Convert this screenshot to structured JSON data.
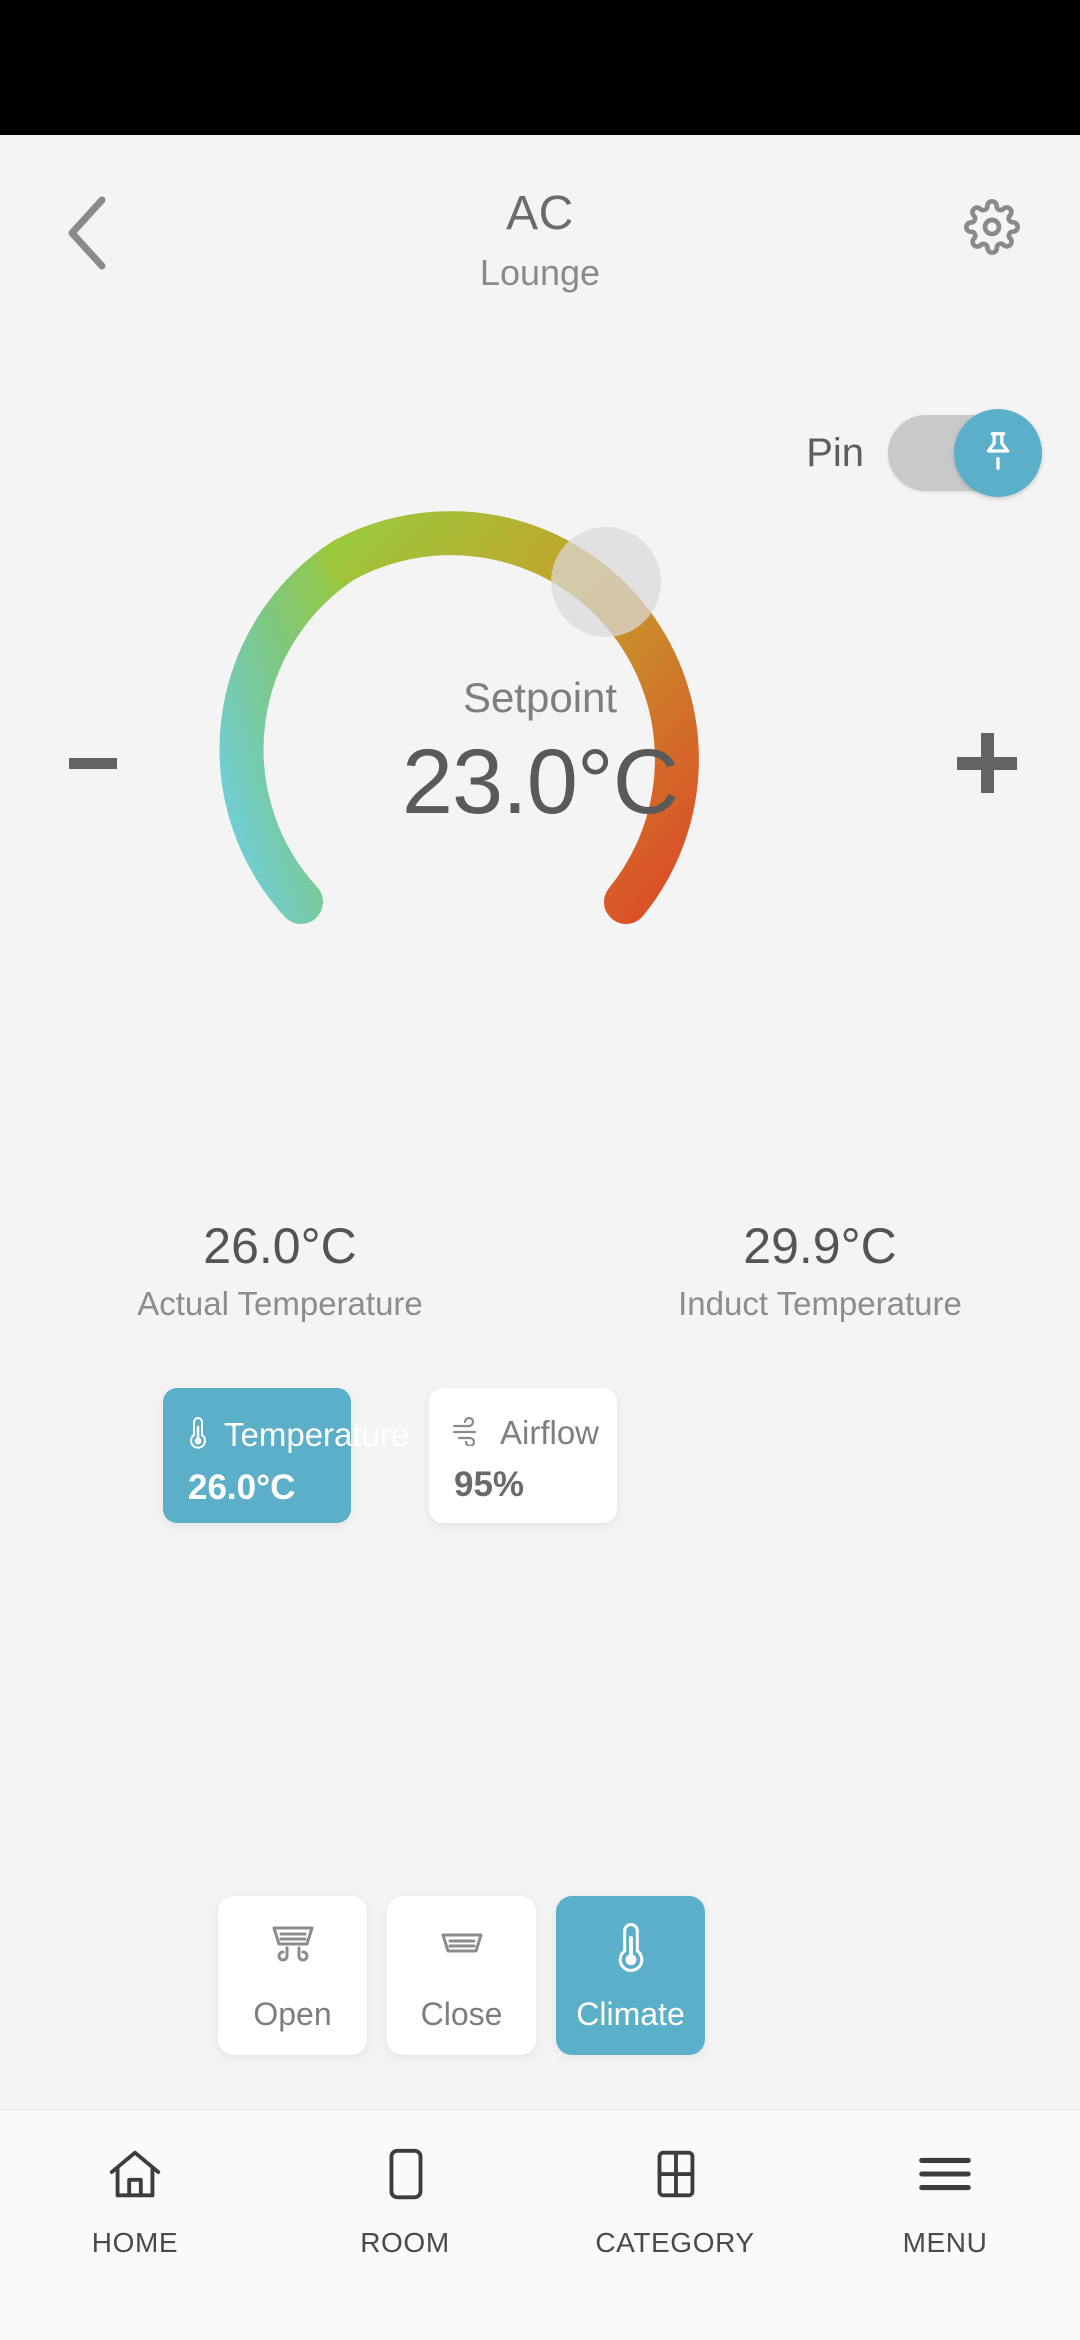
{
  "header": {
    "title": "AC",
    "subtitle": "Lounge",
    "back_icon": "chevron-left-icon",
    "settings_icon": "gear-icon"
  },
  "pin": {
    "label": "Pin",
    "state": "on",
    "icon": "pushpin-icon",
    "knob_color": "#5cafc9",
    "track_color": "#c9c9c9"
  },
  "dial": {
    "setpoint_label": "Setpoint",
    "setpoint_value": "23.0°C",
    "decrease_label": "−",
    "increase_label": "+",
    "thumb_angle_deg": 45,
    "gradient": {
      "cold": "#6fcfde",
      "mid": "#8dc63f",
      "warm": "#c9a22a",
      "hot": "#dd4b27"
    }
  },
  "readings": [
    {
      "value": "26.0°C",
      "label": "Actual Temperature"
    },
    {
      "value": "29.9°C",
      "label": "Induct Temperature"
    }
  ],
  "metric_cards": [
    {
      "name": "Temperature",
      "value": "26.0°C",
      "icon": "thermometer-icon",
      "active": true
    },
    {
      "name": "Airflow",
      "value": "95%",
      "icon": "wind-icon",
      "active": false
    }
  ],
  "actions": [
    {
      "label": "Open",
      "icon": "vent-open-icon",
      "active": false
    },
    {
      "label": "Close",
      "icon": "vent-closed-icon",
      "active": false
    },
    {
      "label": "Climate",
      "icon": "thermometer-icon",
      "active": true
    }
  ],
  "bottom_nav": [
    {
      "label": "HOME",
      "icon": "home-icon"
    },
    {
      "label": "ROOM",
      "icon": "room-icon"
    },
    {
      "label": "CATEGORY",
      "icon": "grid-icon"
    },
    {
      "label": "MENU",
      "icon": "hamburger-icon"
    }
  ],
  "colors": {
    "accent": "#5cafc9",
    "background": "#f4f4f4",
    "nav_background": "#fafafa"
  }
}
